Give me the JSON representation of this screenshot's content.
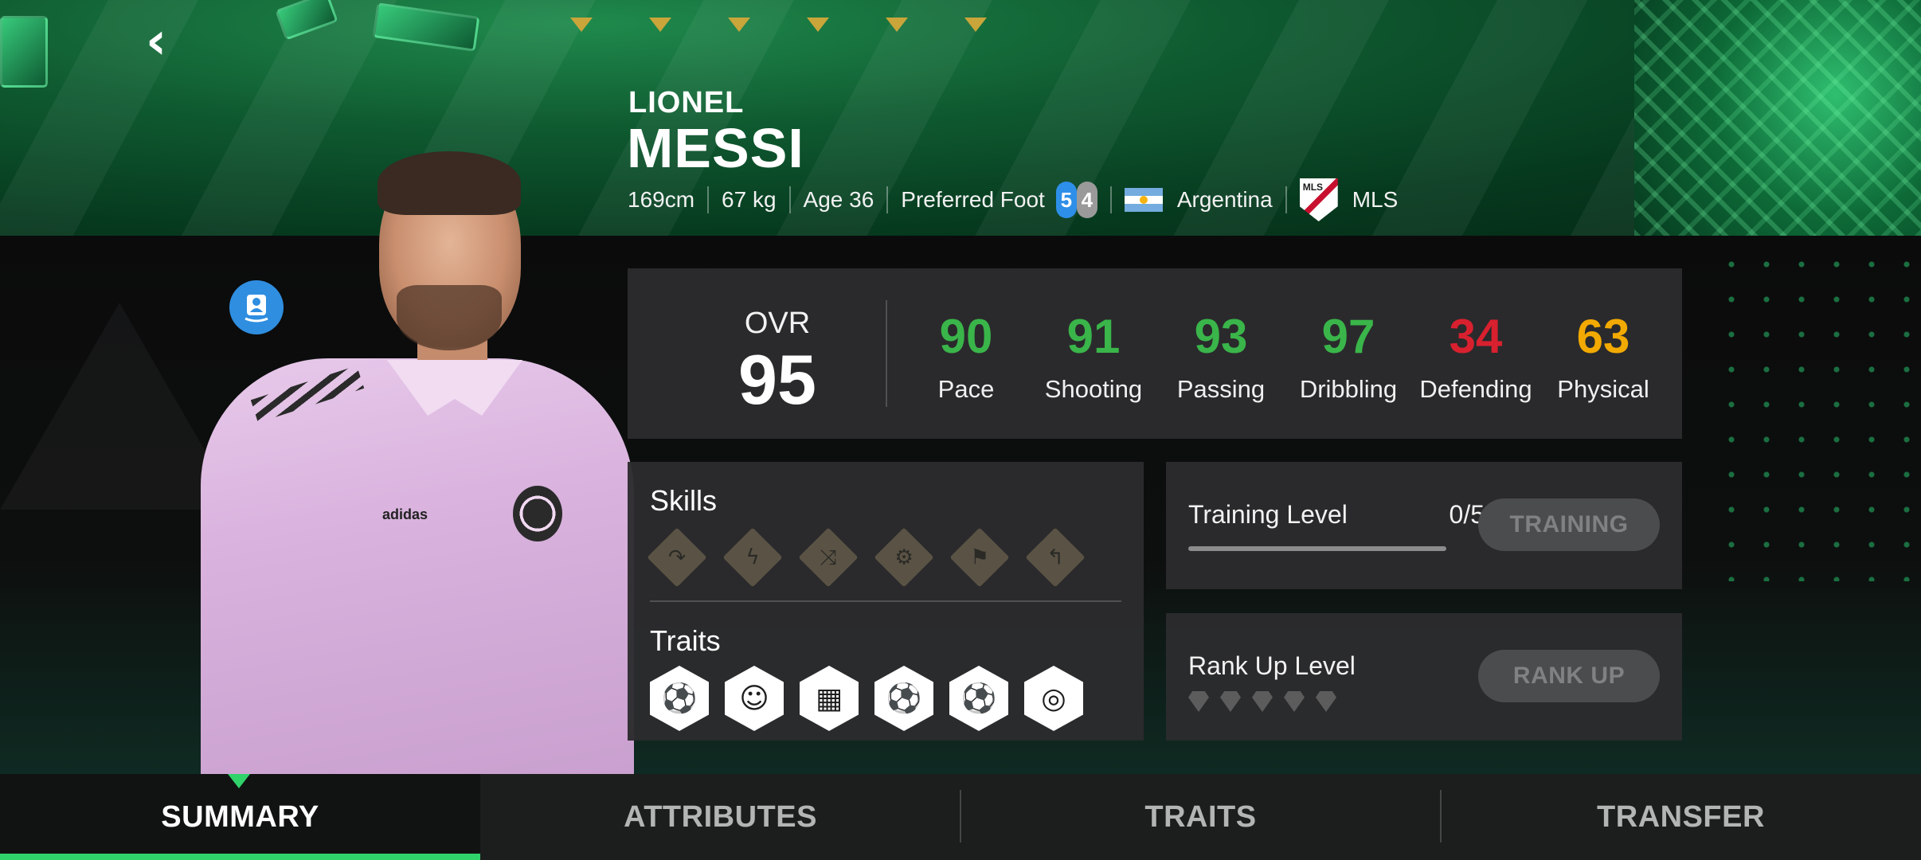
{
  "player": {
    "first_name": "LIONEL",
    "last_name": "MESSI",
    "height": "169cm",
    "weight": "67 kg",
    "age": "Age 36",
    "preferred_foot_label": "Preferred Foot",
    "weak_foot_left": "5",
    "weak_foot_right": "4",
    "nation": "Argentina",
    "league": "MLS",
    "star_rating": 6
  },
  "overall": {
    "label": "OVR",
    "value": "95"
  },
  "stats": [
    {
      "label": "Pace",
      "value": "90",
      "color": "#3ab54a"
    },
    {
      "label": "Shooting",
      "value": "91",
      "color": "#3ab54a"
    },
    {
      "label": "Passing",
      "value": "93",
      "color": "#3ab54a"
    },
    {
      "label": "Dribbling",
      "value": "97",
      "color": "#3ab54a"
    },
    {
      "label": "Defending",
      "value": "34",
      "color": "#d9202f"
    },
    {
      "label": "Physical",
      "value": "63",
      "color": "#f2a900"
    }
  ],
  "skills": {
    "title": "Skills",
    "icons": [
      "swerve-icon",
      "lightning-icon",
      "dribble-path-icon",
      "head-gear-icon",
      "running-player-icon",
      "turn-arrow-icon"
    ]
  },
  "traits": {
    "title": "Traits",
    "icons": [
      "power-ball-icon",
      "celebrating-player-icon",
      "goal-net-icon",
      "ball-header-icon",
      "player-ball-icon",
      "boot-target-icon"
    ]
  },
  "training": {
    "label": "Training Level",
    "count": "0/5",
    "progress": 0,
    "button": "TRAINING"
  },
  "rank": {
    "label": "Rank Up Level",
    "level": 0,
    "max": 5,
    "button": "RANK UP"
  },
  "tabs": [
    {
      "label": "SUMMARY",
      "active": true
    },
    {
      "label": "ATTRIBUTES",
      "active": false
    },
    {
      "label": "TRAITS",
      "active": false
    },
    {
      "label": "TRANSFER",
      "active": false
    }
  ],
  "colors": {
    "accent": "#2fd36a",
    "good_stat": "#3ab54a",
    "bad_stat": "#d9202f",
    "mid_stat": "#f2a900",
    "avatar_button": "#2f8ee0"
  }
}
